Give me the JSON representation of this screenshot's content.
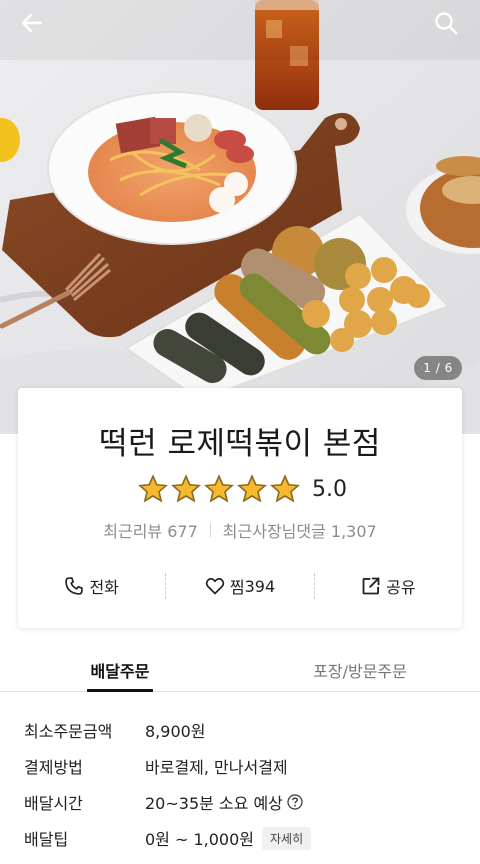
{
  "header": {
    "back_icon": "arrow-left-icon",
    "search_icon": "search-icon",
    "image_counter": "1 / 6"
  },
  "store": {
    "name": "떡런 로제떡볶이 본점",
    "rating": "5.0",
    "star_count": 5,
    "star_color": "#f5b82e",
    "review_label": "최근리뷰 677",
    "owner_reply_label": "최근사장님댓글 1,307"
  },
  "actions": {
    "call_label": "전화",
    "like_label": "찜",
    "like_count": "394",
    "share_label": "공유"
  },
  "tabs": [
    {
      "label": "배달주문",
      "active": true
    },
    {
      "label": "포장/방문주문",
      "active": false
    }
  ],
  "info": {
    "min_order_label": "최소주문금액",
    "min_order_value": "8,900원",
    "payment_label": "결제방법",
    "payment_value": "바로결제, 만나서결제",
    "delivery_time_label": "배달시간",
    "delivery_time_value": "20~35분 소요 예상",
    "delivery_tip_label": "배달팁",
    "delivery_tip_value": "0원 ~ 1,000원",
    "detail_button": "자세히"
  }
}
